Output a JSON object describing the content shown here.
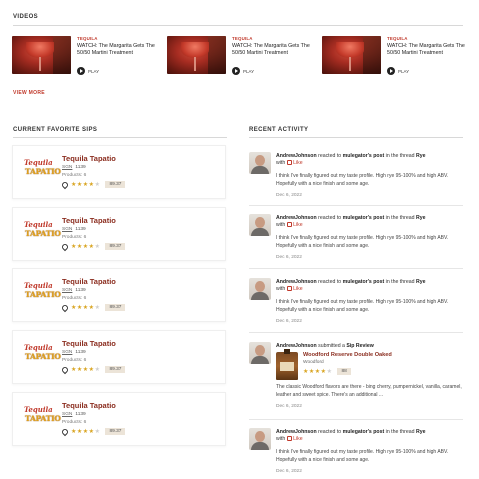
{
  "videos": {
    "title": "VIDEOS",
    "items": [
      {
        "tag": "TEQUILA",
        "title": "WATCH: The Margarita Gets The 50/50 Martini Treatment",
        "play": "PLAY"
      },
      {
        "tag": "TEQUILA",
        "title": "WATCH: The Margarita Gets The 50/50 Martini Treatment",
        "play": "PLAY"
      },
      {
        "tag": "TEQUILA",
        "title": "WATCH: The Margarita Gets The 50/50 Martini Treatment",
        "play": "PLAY"
      }
    ],
    "view_more": "VIEW MORE"
  },
  "sips": {
    "title": "CURRENT FAVORITE SIPS",
    "items": [
      {
        "logo_top": "Tequila",
        "logo_bottom": "TAPATIO",
        "name": "Tequila Tapatio",
        "sgn": "SGN",
        "sgn_value": "1139",
        "products": "Products: 6",
        "rating": 4,
        "score": "89.37"
      },
      {
        "logo_top": "Tequila",
        "logo_bottom": "TAPATIO",
        "name": "Tequila Tapatio",
        "sgn": "SGN",
        "sgn_value": "1139",
        "products": "Products: 6",
        "rating": 4,
        "score": "89.37"
      },
      {
        "logo_top": "Tequila",
        "logo_bottom": "TAPATIO",
        "name": "Tequila Tapatio",
        "sgn": "SGN",
        "sgn_value": "1139",
        "products": "Products: 6",
        "rating": 4,
        "score": "89.37"
      },
      {
        "logo_top": "Tequila",
        "logo_bottom": "TAPATIO",
        "name": "Tequila Tapatio",
        "sgn": "SGN",
        "sgn_value": "1139",
        "products": "Products: 6",
        "rating": 4,
        "score": "89.37"
      },
      {
        "logo_top": "Tequila",
        "logo_bottom": "TAPATIO",
        "name": "Tequila Tapatio",
        "sgn": "SGN",
        "sgn_value": "1139",
        "products": "Products: 6",
        "rating": 4,
        "score": "89.37"
      }
    ]
  },
  "activity": {
    "title": "RECENT ACTIVITY",
    "items": [
      {
        "user": "AndrewJohnson",
        "action": "reacted to",
        "target": "mulegator's post",
        "context": "in the thread",
        "thread": "Rye",
        "with": "with",
        "like": "Like",
        "body": "I think I've finally figured out my taste profile. High rye 95-100% and high ABV. Hopefully with a nice finish and some age.",
        "date": "Dec 6, 2022"
      },
      {
        "user": "AndrewJohnson",
        "action": "reacted to",
        "target": "mulegator's post",
        "context": "in the thread",
        "thread": "Rye",
        "with": "with",
        "like": "Like",
        "body": "I think I've finally figured out my taste profile. High rye 95-100% and high ABV. Hopefully with a nice finish and some age.",
        "date": "Dec 6, 2022"
      },
      {
        "user": "AndrewJohnson",
        "action": "reacted to",
        "target": "mulegator's post",
        "context": "in the thread",
        "thread": "Rye",
        "with": "with",
        "like": "Like",
        "body": "I think I've finally figured out my taste profile. High rye 95-100% and high ABV. Hopefully with a nice finish and some age.",
        "date": "Dec 6, 2022"
      },
      {
        "user": "AndrewJohnson",
        "action": "submitted a",
        "target": "Sip Review",
        "review_name": "Woodford Reserve Double Oaked",
        "review_brand": "Woodford",
        "rating": 4,
        "score": "88",
        "body": "The classic Woodford flavors are there - bing cherry, pumpernickel, vanilla, caramel, leather and sweet spice. There's an additional ...",
        "date": "Dec 6, 2022"
      },
      {
        "user": "AndrewJohnson",
        "action": "reacted to",
        "target": "mulegator's post",
        "context": "in the thread",
        "thread": "Rye",
        "with": "with",
        "like": "Like",
        "body": "I think I've finally figured out my taste profile. High rye 95-100% and high ABV. Hopefully with a nice finish and some age.",
        "date": "Dec 6, 2022"
      }
    ]
  },
  "colors": {
    "accent": "#c0392b",
    "brand_dark": "#8b2d1f",
    "star": "#d9a522"
  }
}
